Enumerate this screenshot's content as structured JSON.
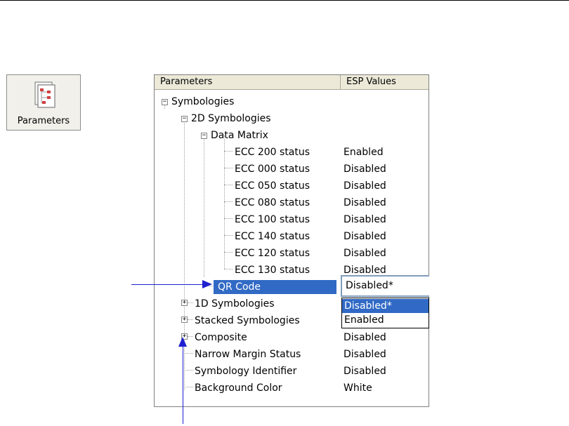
{
  "button": {
    "label": "Parameters",
    "icon": "parameters-document-icon"
  },
  "table": {
    "headers": [
      "Parameters",
      "ESP Values"
    ],
    "rows": [
      {
        "label": "Symbologies",
        "value": ""
      },
      {
        "label": "2D Symbologies",
        "value": ""
      },
      {
        "label": "Data Matrix",
        "value": ""
      },
      {
        "label": "ECC 200 status",
        "value": "Enabled"
      },
      {
        "label": "ECC 000 status",
        "value": "Disabled"
      },
      {
        "label": "ECC 050 status",
        "value": "Disabled"
      },
      {
        "label": "ECC 080 status",
        "value": "Disabled"
      },
      {
        "label": "ECC 100 status",
        "value": "Disabled"
      },
      {
        "label": "ECC 140 status",
        "value": "Disabled"
      },
      {
        "label": "ECC 120 status",
        "value": "Disabled"
      },
      {
        "label": "ECC 130 status",
        "value": "Disabled"
      },
      {
        "label": "QR Code",
        "value": ""
      },
      {
        "label": "1D Symbologies",
        "value": ""
      },
      {
        "label": "Stacked Symbologies",
        "value": ""
      },
      {
        "label": "Composite",
        "value": "Disabled"
      },
      {
        "label": "Narrow Margin Status",
        "value": "Disabled"
      },
      {
        "label": "Symbology Identifier",
        "value": "Disabled"
      },
      {
        "label": "Background Color",
        "value": "White"
      }
    ]
  },
  "combo": {
    "value": "Disabled*",
    "options": [
      "Disabled*",
      "Enabled"
    ]
  },
  "colors": {
    "selection": "#316ac5",
    "arrow": "#1f1fd0"
  }
}
